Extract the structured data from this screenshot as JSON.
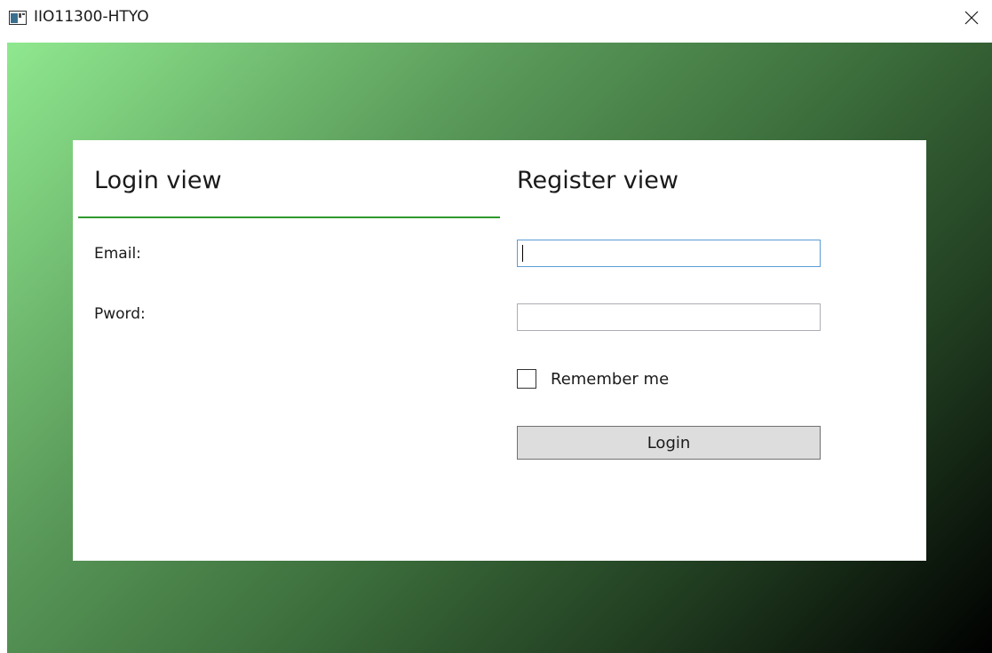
{
  "window": {
    "title": "IIO11300-HTYO"
  },
  "icons": {
    "app": "app-window-icon",
    "close": "close-icon"
  },
  "login_view": {
    "header": "Login view",
    "email_label": "Email:",
    "password_label": "Pword:"
  },
  "register_view": {
    "header": "Register view",
    "email_value": "",
    "password_value": "",
    "remember_label": "Remember me",
    "remember_checked": false,
    "login_button": "Login"
  },
  "colors": {
    "accent_underline": "#2e9a2e",
    "focus_border": "#5b9bd5",
    "gradient_start": "#8fe88f",
    "gradient_end": "#000000",
    "button_bg": "#dddddd"
  }
}
